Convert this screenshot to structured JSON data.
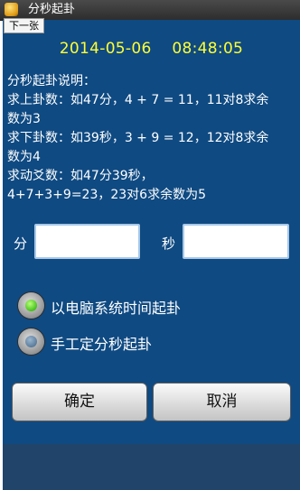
{
  "window": {
    "title": "分秒起卦",
    "tooltip": "下一张"
  },
  "datetime": {
    "date": "2014-05-06",
    "time": "08:48:05"
  },
  "instructions": {
    "heading": "分秒起卦说明：",
    "lines": [
      "求上卦数：如47分，4 + 7 = 11，11对8求余",
      "数为3",
      "求下卦数：如39秒，3 + 9 = 12，12对8求余",
      "数为4",
      "求动爻数：如47分39秒，",
      "4+7+3+9=23，23对6求余数为5"
    ]
  },
  "inputs": {
    "minute": {
      "label": "分",
      "value": ""
    },
    "second": {
      "label": "秒",
      "value": ""
    }
  },
  "options": [
    {
      "label": "以电脑系统时间起卦",
      "checked": true
    },
    {
      "label": "手工定分秒起卦",
      "checked": false
    }
  ],
  "buttons": {
    "confirm": "确定",
    "cancel": "取消"
  },
  "colors": {
    "background": "#0f4a82",
    "datetime": "#ffff33",
    "accent": "#44c21a"
  }
}
